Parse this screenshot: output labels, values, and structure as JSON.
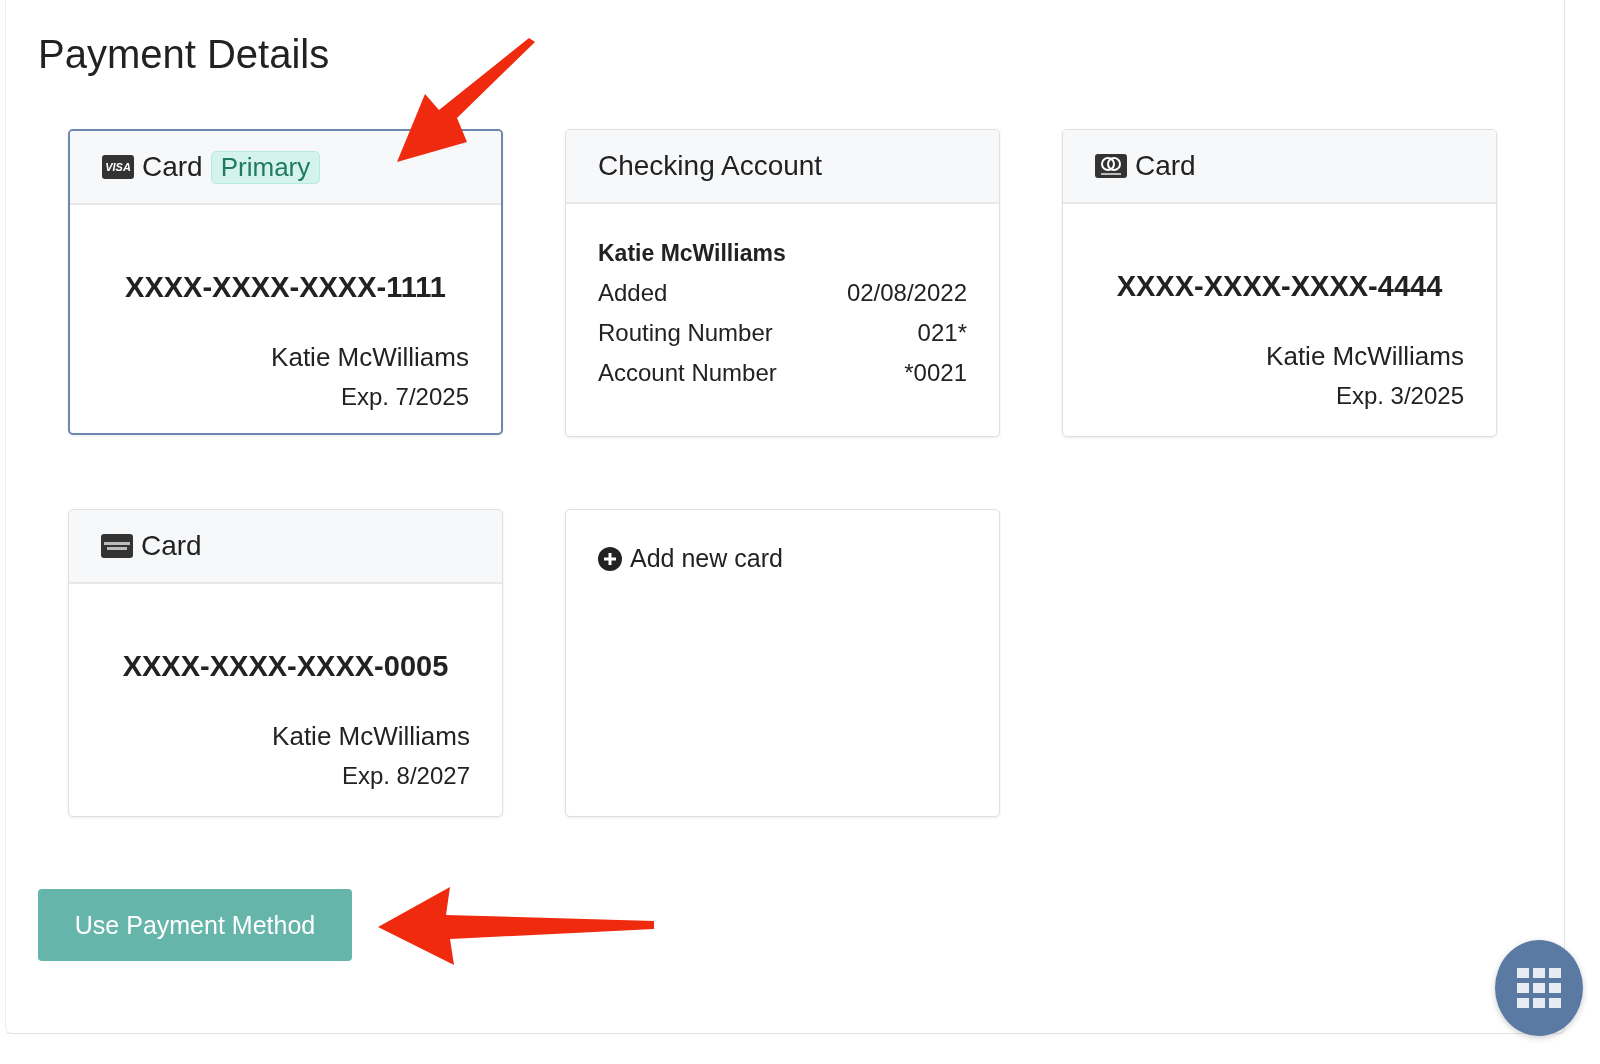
{
  "title": "Payment Details",
  "methods": [
    {
      "kind": "card",
      "logo": {
        "kind": "visa",
        "text": "VISA"
      },
      "label": "Card",
      "badge": "Primary",
      "selected": true,
      "number": "XXXX-XXXX-XXXX-1111",
      "holder": "Katie McWilliams",
      "expiry": "Exp. 7/2025"
    },
    {
      "kind": "bank",
      "label": "Checking Account",
      "selected": false,
      "holder": "Katie McWilliams",
      "details": [
        {
          "label": "Added",
          "value": "02/08/2022"
        },
        {
          "label": "Routing Number",
          "value": "021*"
        },
        {
          "label": "Account Number",
          "value": "*0021"
        }
      ]
    },
    {
      "kind": "card",
      "logo": {
        "kind": "mastercard"
      },
      "label": "Card",
      "selected": false,
      "number": "XXXX-XXXX-XXXX-4444",
      "holder": "Katie McWilliams",
      "expiry": "Exp. 3/2025"
    },
    {
      "kind": "card",
      "logo": {
        "kind": "amex"
      },
      "label": "Card",
      "selected": false,
      "number": "XXXX-XXXX-XXXX-0005",
      "holder": "Katie McWilliams",
      "expiry": "Exp. 8/2027"
    },
    {
      "kind": "add",
      "label": "Add new card"
    }
  ],
  "primary_button": "Use Payment Method"
}
